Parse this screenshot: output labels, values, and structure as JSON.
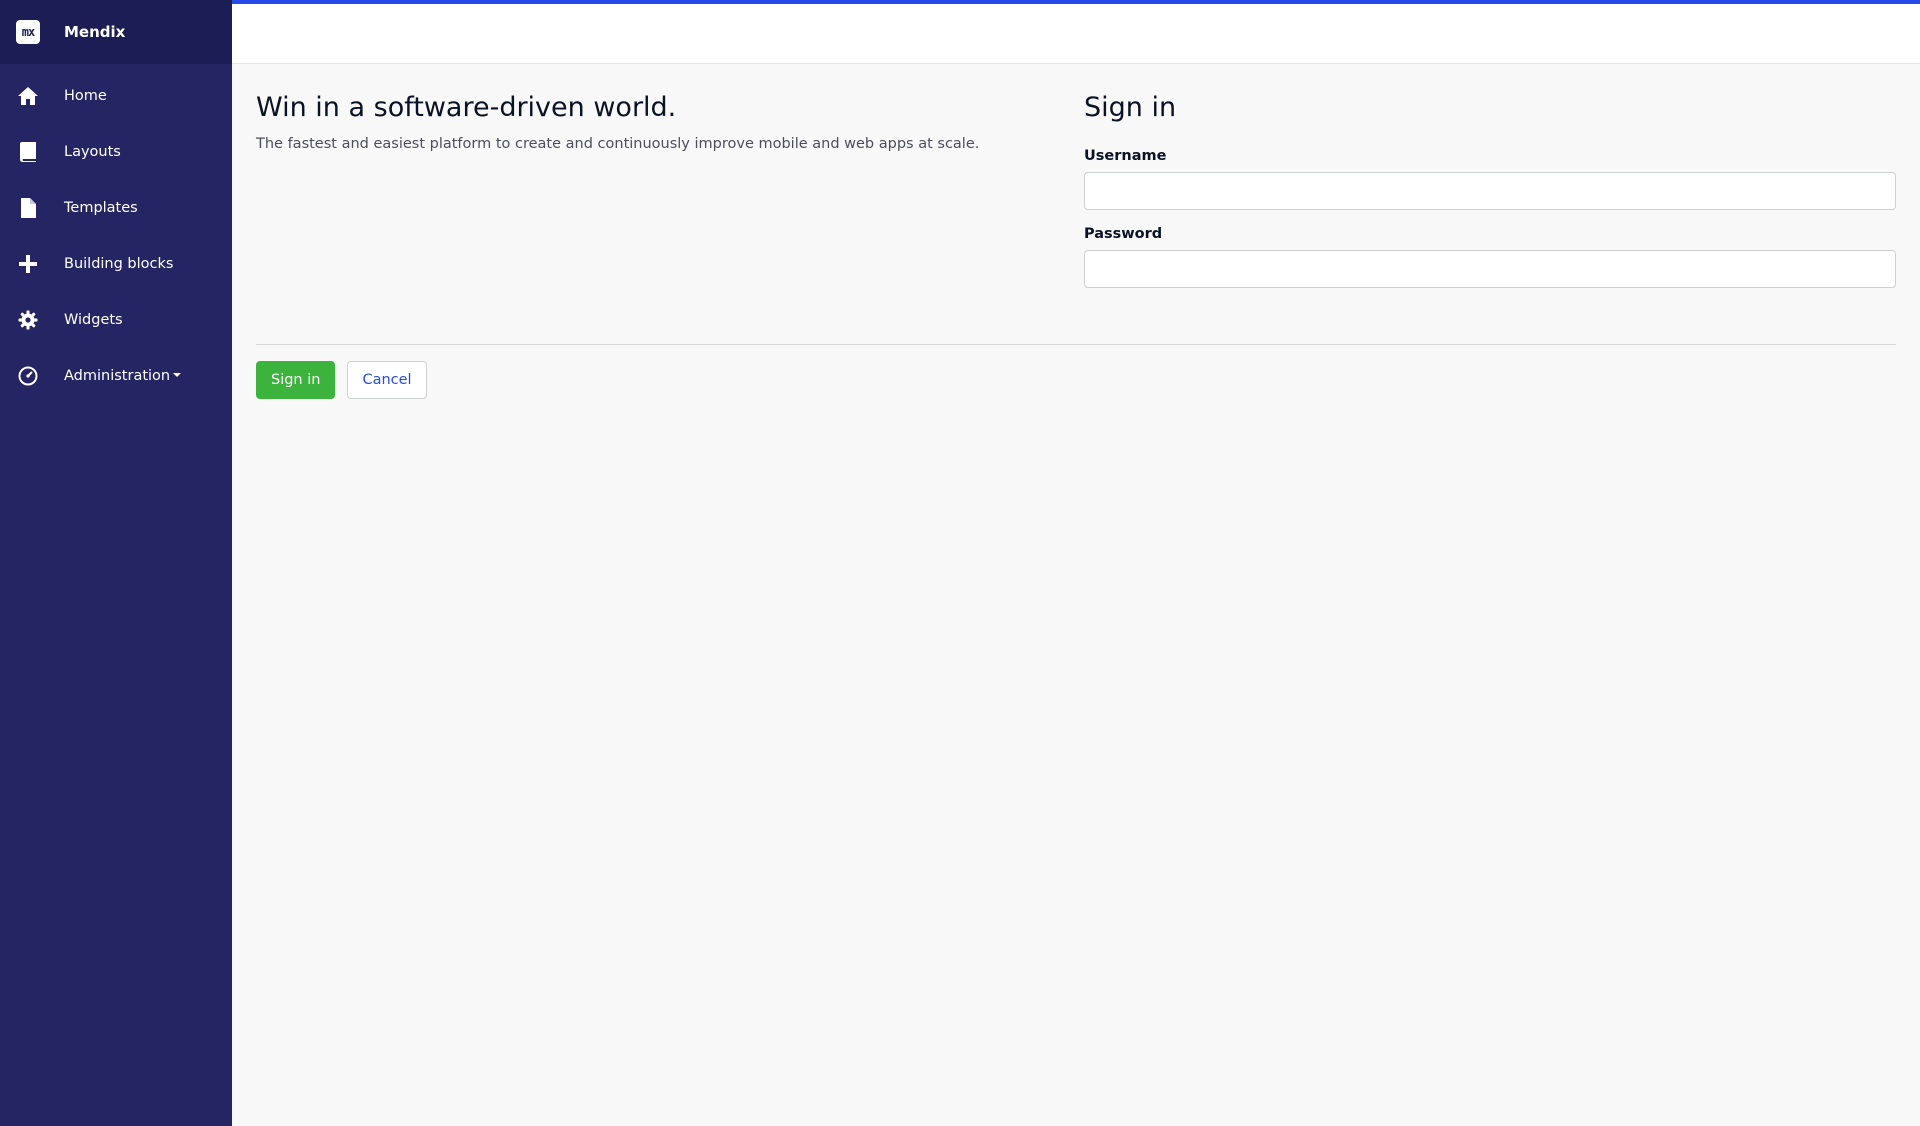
{
  "sidebar": {
    "brand": {
      "logo_text": "mx",
      "name": "Mendix"
    },
    "items": [
      {
        "label": "Home",
        "icon": "home-icon"
      },
      {
        "label": "Layouts",
        "icon": "book-icon"
      },
      {
        "label": "Templates",
        "icon": "file-icon"
      },
      {
        "label": "Building blocks",
        "icon": "plus-icon"
      },
      {
        "label": "Widgets",
        "icon": "gear-icon"
      },
      {
        "label": "Administration",
        "icon": "dashboard-icon",
        "has_dropdown": true
      }
    ]
  },
  "topbar": {
    "accent_color": "#264ae5"
  },
  "hero": {
    "title": "Win in a software-driven world.",
    "subtitle": "The fastest and easiest platform to create and continuously improve mobile and web apps at scale."
  },
  "signin": {
    "title": "Sign in",
    "username_label": "Username",
    "username_value": "",
    "password_label": "Password",
    "password_value": ""
  },
  "actions": {
    "signin_label": "Sign in",
    "cancel_label": "Cancel"
  },
  "colors": {
    "sidebar_bg": "#252563",
    "brand_bg": "#1d1d55",
    "primary_button": "#3cb33d",
    "link": "#264ae5",
    "page_bg": "#f8f8f8"
  }
}
